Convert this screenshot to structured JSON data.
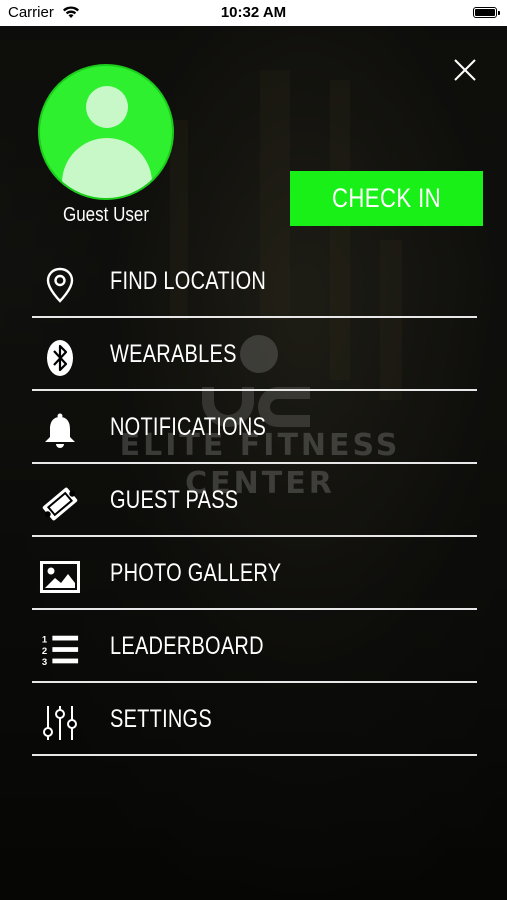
{
  "status_bar": {
    "carrier": "Carrier",
    "time": "10:32 AM"
  },
  "watermark": {
    "line1": "ELITE FITNESS",
    "line2": "CENTER"
  },
  "profile": {
    "name": "Guest User"
  },
  "check_in": {
    "label": "CHECK IN",
    "color": "#18f018"
  },
  "menu": {
    "items": [
      {
        "label": "FIND LOCATION",
        "icon": "location-pin-icon"
      },
      {
        "label": "WEARABLES",
        "icon": "bluetooth-icon"
      },
      {
        "label": "NOTIFICATIONS",
        "icon": "bell-icon"
      },
      {
        "label": "GUEST PASS",
        "icon": "ticket-icon"
      },
      {
        "label": "PHOTO GALLERY",
        "icon": "image-icon"
      },
      {
        "label": "LEADERBOARD",
        "icon": "numbered-list-icon"
      },
      {
        "label": "SETTINGS",
        "icon": "sliders-icon"
      }
    ]
  },
  "colors": {
    "accent": "#18f018",
    "avatar": "#2ef02e",
    "divider": "#e8e8e8"
  }
}
